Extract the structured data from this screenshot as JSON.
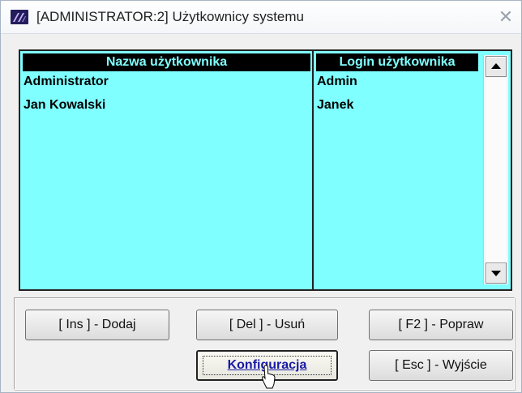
{
  "window": {
    "title": "[ADMINISTRATOR:2]  Użytkownicy systemu",
    "close_label": "✕"
  },
  "table": {
    "columns": [
      "Nazwa użytkownika",
      "Login użytkownika"
    ],
    "rows": [
      {
        "name": "Administrator",
        "login": "Admin"
      },
      {
        "name": "Jan Kowalski",
        "login": "Janek"
      }
    ],
    "background_color": "#7fffff",
    "header_color": "#000000"
  },
  "buttons": {
    "insert": "[ Ins ] - Dodaj",
    "delete": "[ Del ] - Usuń",
    "edit": "[ F2 ] - Popraw",
    "configure": "Konfiguracja",
    "exit": "[ Esc ] - Wyjście"
  },
  "icons": {
    "app": "app-logo-icon",
    "close": "close-icon",
    "scroll_up": "scroll-up-arrow-icon",
    "scroll_down": "scroll-down-arrow-icon",
    "cursor": "mouse-pointer-icon"
  }
}
